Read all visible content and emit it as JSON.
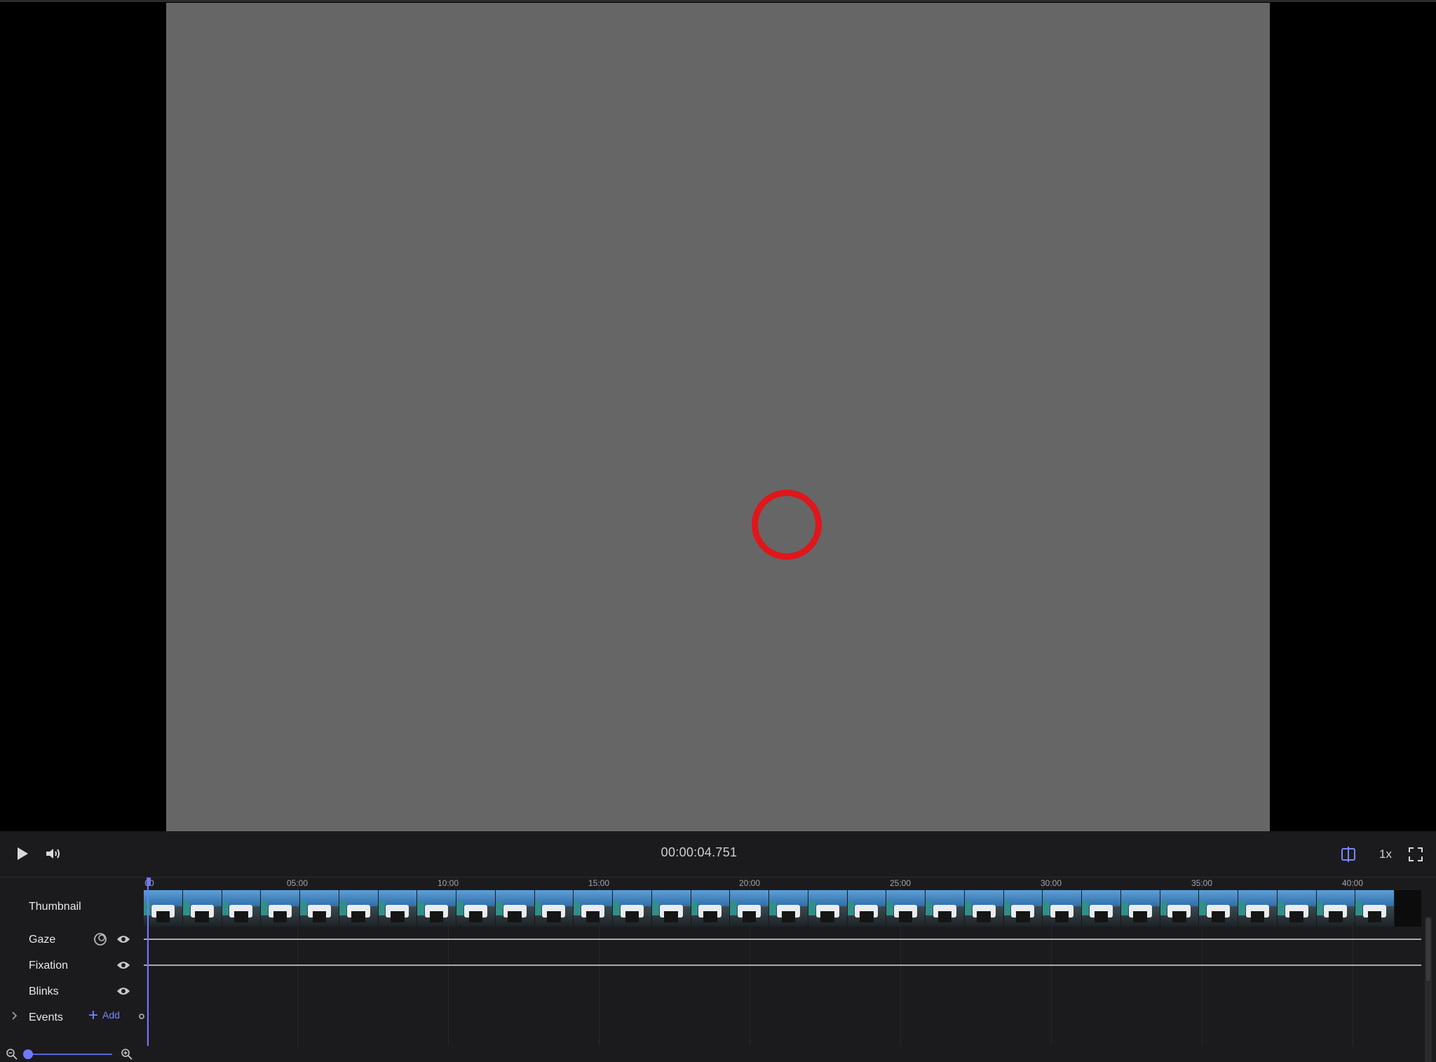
{
  "player": {
    "timecode": "00:00:04.751",
    "speed_label": "1x"
  },
  "timeline": {
    "ticks": [
      "00",
      "05:00",
      "10:00",
      "15:00",
      "20:00",
      "25:00",
      "30:00",
      "35:00",
      "40:00"
    ],
    "tracks": {
      "thumbnail": "Thumbnail",
      "gaze": "Gaze",
      "fixation": "Fixation",
      "blinks": "Blinks",
      "events": "Events"
    },
    "add_label": "Add",
    "playhead_position_min": 0.08
  },
  "icons": {
    "play": "play-icon",
    "volume": "volume-icon",
    "split": "split-view-icon",
    "fullscreen": "fullscreen-icon",
    "eye": "eye-icon",
    "gaze_settings": "gaze-offset-icon",
    "zoom_out": "zoom-out-icon",
    "zoom_in": "zoom-in-icon",
    "chevron": "chevron-right-icon",
    "plus": "plus-icon"
  },
  "colors": {
    "accent": "#6f79ff",
    "gaze_circle": "#e0161b",
    "frame_gray": "#666666",
    "panel_bg": "#1b1b1e"
  }
}
